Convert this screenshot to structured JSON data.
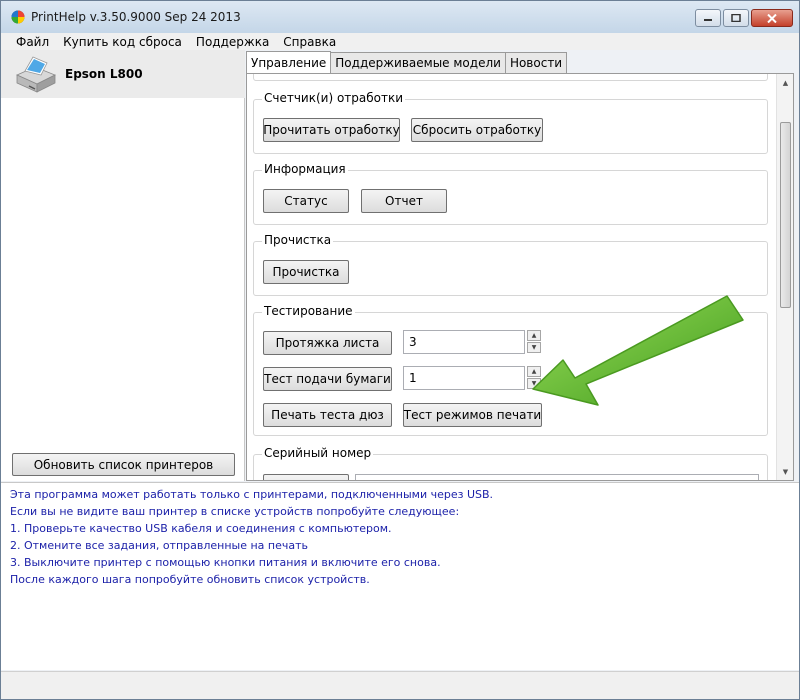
{
  "window": {
    "title": "PrintHelp v.3.50.9000 Sep 24 2013"
  },
  "menu": [
    "Файл",
    "Купить код сброса",
    "Поддержка",
    "Справка"
  ],
  "printer": {
    "name": "Epson L800"
  },
  "refresh_button": "Обновить список принтеров",
  "tabs": [
    "Управление",
    "Поддерживаемые модели",
    "Новости"
  ],
  "groups": {
    "counters": {
      "title": "Счетчик(и) отработки",
      "read": "Прочитать отработку",
      "reset": "Сбросить отработку"
    },
    "info": {
      "title": "Информация",
      "status": "Статус",
      "report": "Отчет"
    },
    "cleaning": {
      "title": "Прочистка",
      "clean": "Прочистка"
    },
    "testing": {
      "title": "Тестирование",
      "sheet_feed": "Протяжка листа",
      "sheet_feed_value": "3",
      "paper_feed_test": "Тест подачи бумаги",
      "paper_feed_value": "1",
      "nozzle_print": "Печать теста дюз",
      "print_modes_test": "Тест режимов печати"
    },
    "serial": {
      "title": "Серийный номер"
    }
  },
  "info_text": [
    "Эта программа может работать только с принтерами, подключенными через USB.",
    "Если вы не видите ваш принтер в списке устройств попробуйте следующее:",
    "1. Проверьте качество USB кабеля и соединения с компьютером.",
    "2. Отмените все задания, отправленные на печать",
    "3. Выключите принтер с помощью кнопки питания и включите его снова.",
    "После каждого шага попробуйте обновить список устройств."
  ],
  "colors": {
    "info_text": "#1a1fa8",
    "arrow": "#5cb82e"
  }
}
